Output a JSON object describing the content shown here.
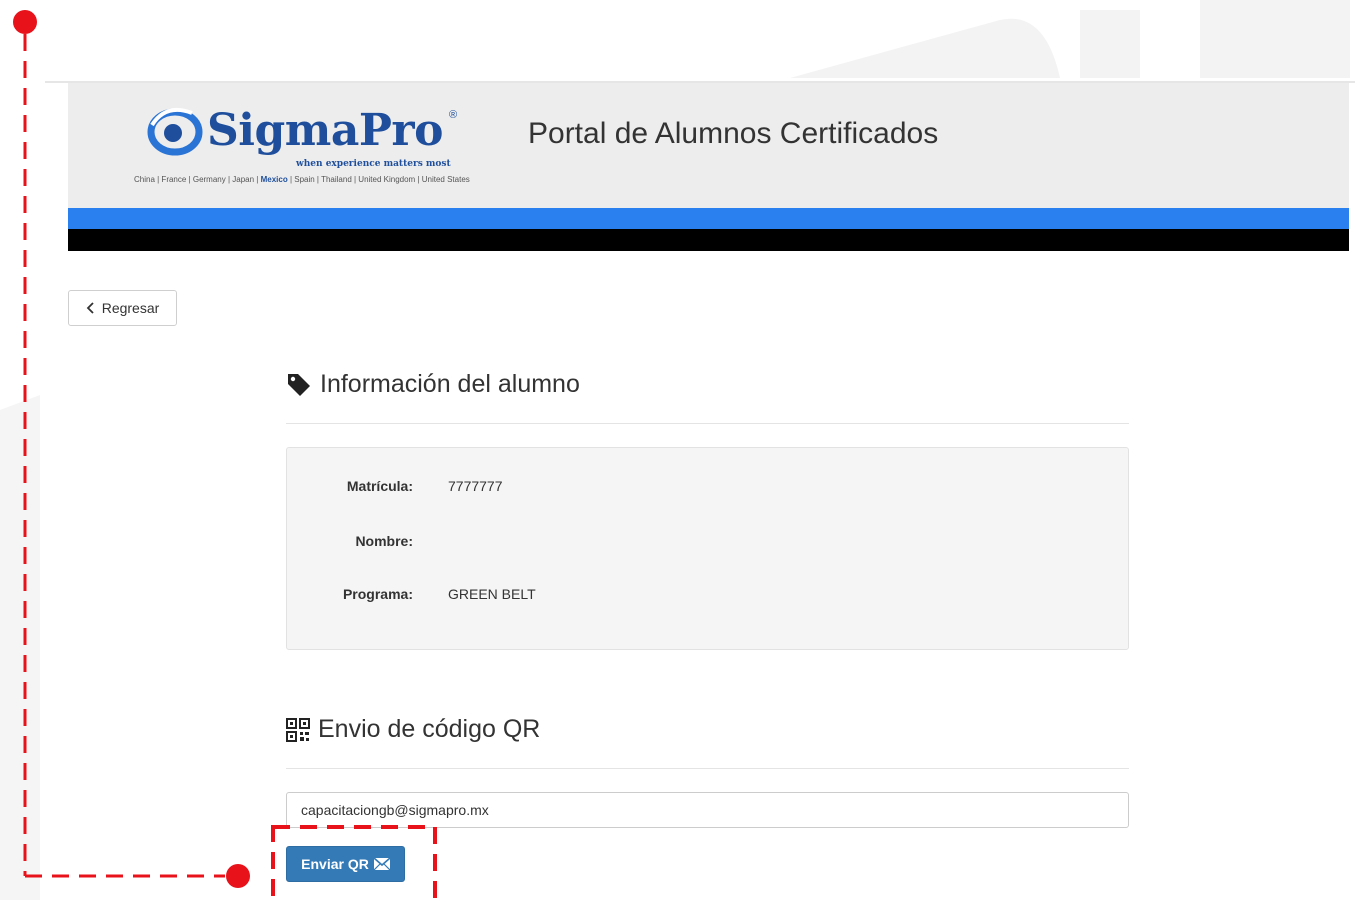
{
  "header": {
    "logo_wordmark": "SigmaPro",
    "logo_registered": "®",
    "logo_tagline": "when experience matters most",
    "logo_countries_before": "China | France | Germany | Japan | ",
    "logo_countries_highlight": "Mexico",
    "logo_countries_after": " | Spain | Thailand | United Kingdom | United States",
    "portal_title": "Portal de Alumnos Certificados"
  },
  "back_button": {
    "label": "Regresar"
  },
  "student_section": {
    "title": "Información del alumno",
    "fields": [
      {
        "label": "Matrícula:",
        "value": "7777777"
      },
      {
        "label": "Nombre:",
        "value": ""
      },
      {
        "label": "Programa:",
        "value": "GREEN BELT"
      }
    ]
  },
  "qr_section": {
    "title": "Envio de código QR",
    "email_value": "capacitaciongb@sigmapro.mx",
    "send_label": "Enviar QR"
  },
  "colors": {
    "brand_blue": "#1f4f9c",
    "header_blue_band": "#2a80ef",
    "button_primary": "#337ab7",
    "annotation_red": "#e8121b"
  }
}
